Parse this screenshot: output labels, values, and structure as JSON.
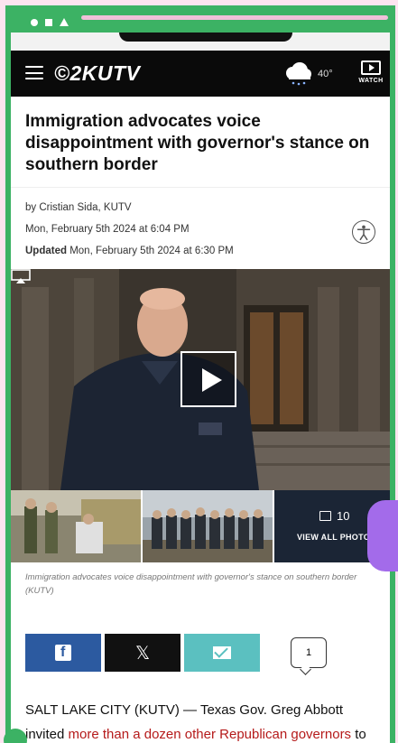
{
  "header": {
    "logo": "©2KUTV",
    "temperature": "40°",
    "watch_label": "WATCH"
  },
  "article": {
    "headline": "Immigration advocates voice disappointment with governor's stance on southern border",
    "author": "by Cristian Sida, KUTV",
    "published": "Mon, February 5th 2024 at 6:04 PM",
    "updated_label": "Updated",
    "updated": "Mon, February 5th 2024 at 6:30 PM",
    "caption": "Immigration advocates voice disappointment with governor's stance on southern border (KUTV)",
    "body_prefix": "SALT LAKE CITY (KUTV) — Texas Gov. Greg Abbott invited ",
    "body_link": "more than a dozen other Republican governors",
    "body_suffix": " to tour part of the border with Mexico"
  },
  "gallery": {
    "count": "10",
    "view_all": "VIEW ALL PHOTOS"
  },
  "share": {
    "comment_count": "1",
    "x_glyph": "𝕏"
  },
  "colors": {
    "frame_green": "#3cb264",
    "background_pink": "#fce4ef",
    "facebook_blue": "#2c5aa0",
    "email_teal": "#5bc0c0",
    "link_red": "#b51a1a",
    "accent_purple": "#a36bea"
  }
}
